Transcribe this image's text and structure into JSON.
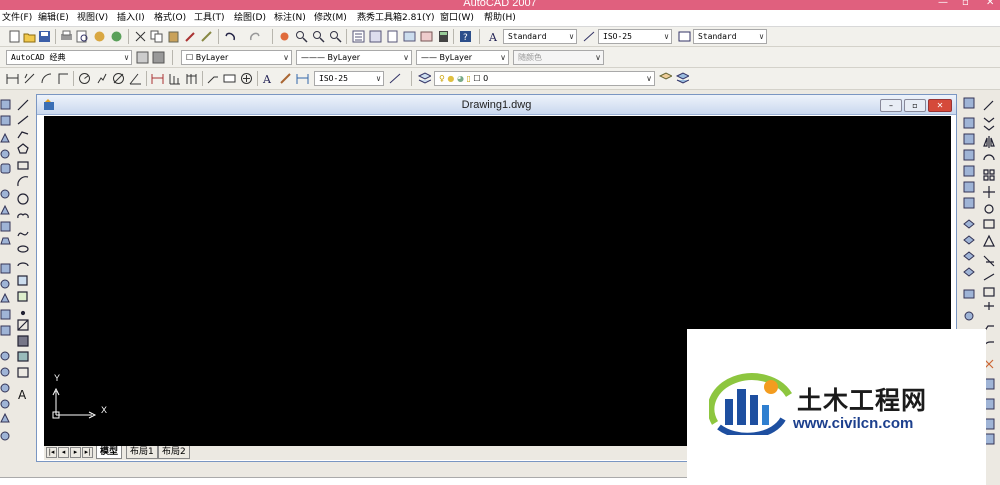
{
  "window": {
    "title": "AutoCAD 2007"
  },
  "menus": [
    "文件(F)",
    "编辑(E)",
    "视图(V)",
    "插入(I)",
    "格式(O)",
    "工具(T)",
    "绘图(D)",
    "标注(N)",
    "修改(M)",
    "燕秀工具箱2.81(Y)",
    "窗口(W)",
    "帮助(H)"
  ],
  "styles_toolbar": {
    "text_style": "Standard",
    "dim_style": "ISO-25",
    "table_style": "Standard"
  },
  "workspace": {
    "name": "AutoCAD 经典"
  },
  "properties": {
    "color": "ByLayer",
    "linetype": "ByLayer",
    "lineweight": "ByLayer",
    "plotstyle": "随颜色"
  },
  "dimension_toolbar": {
    "dim_style": "ISO-25"
  },
  "layer": {
    "current": "0"
  },
  "drawing": {
    "title": "Drawing1.dwg",
    "ucs_y": "Y",
    "ucs_x": "X"
  },
  "tabs": [
    "模型",
    "布局1",
    "布局2"
  ],
  "watermark": {
    "cn": "土木工程网",
    "url": "www.civilcn.com"
  },
  "colors": {
    "titlebar": "#e0607e",
    "canvas": "#000000",
    "accent": "#1c3f8d"
  }
}
